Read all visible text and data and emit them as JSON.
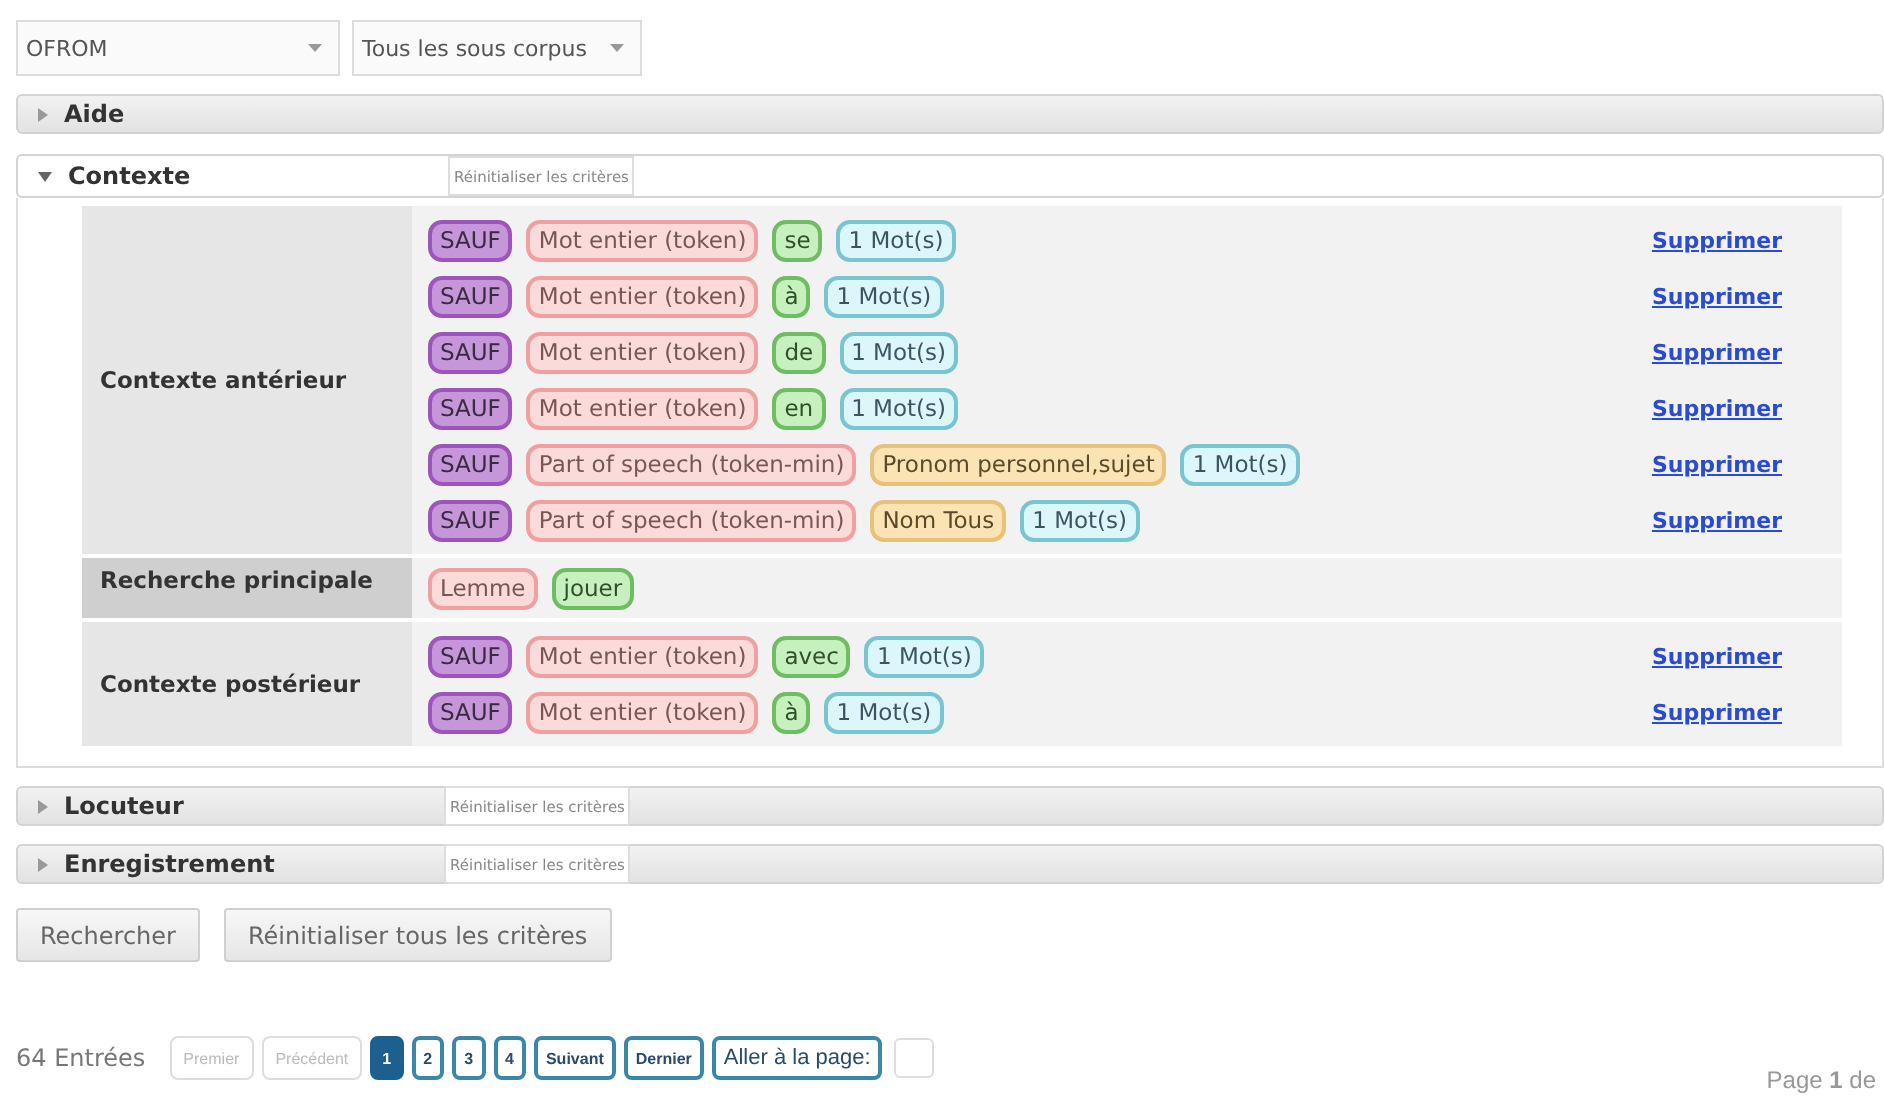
{
  "selects": [
    {
      "value": "OFROM"
    },
    {
      "value": "Tous les sous corpus"
    }
  ],
  "sections": [
    {
      "title": "Aide",
      "expanded": false
    },
    {
      "title": "Contexte",
      "expanded": true,
      "reset": "Réinitialiser les critères",
      "groups": [
        {
          "label": "Contexte antérieur",
          "kind": "context",
          "rows": [
            {
              "tags": [
                {
                  "kind": "sauf",
                  "text": "SAUF"
                },
                {
                  "kind": "field",
                  "text": "Mot entier (token)"
                },
                {
                  "kind": "value",
                  "text": "se"
                },
                {
                  "kind": "count",
                  "text": "1 Mot(s)"
                }
              ],
              "action": "Supprimer"
            },
            {
              "tags": [
                {
                  "kind": "sauf",
                  "text": "SAUF"
                },
                {
                  "kind": "field",
                  "text": "Mot entier (token)"
                },
                {
                  "kind": "value",
                  "text": "à"
                },
                {
                  "kind": "count",
                  "text": "1 Mot(s)"
                }
              ],
              "action": "Supprimer"
            },
            {
              "tags": [
                {
                  "kind": "sauf",
                  "text": "SAUF"
                },
                {
                  "kind": "field",
                  "text": "Mot entier (token)"
                },
                {
                  "kind": "value",
                  "text": "de"
                },
                {
                  "kind": "count",
                  "text": "1 Mot(s)"
                }
              ],
              "action": "Supprimer"
            },
            {
              "tags": [
                {
                  "kind": "sauf",
                  "text": "SAUF"
                },
                {
                  "kind": "field",
                  "text": "Mot entier (token)"
                },
                {
                  "kind": "value",
                  "text": "en"
                },
                {
                  "kind": "count",
                  "text": "1 Mot(s)"
                }
              ],
              "action": "Supprimer"
            },
            {
              "tags": [
                {
                  "kind": "sauf",
                  "text": "SAUF"
                },
                {
                  "kind": "field",
                  "text": "Part of speech (token-min)"
                },
                {
                  "kind": "pos",
                  "text": "Pronom personnel,sujet"
                },
                {
                  "kind": "count",
                  "text": "1 Mot(s)"
                }
              ],
              "action": "Supprimer"
            },
            {
              "tags": [
                {
                  "kind": "sauf",
                  "text": "SAUF"
                },
                {
                  "kind": "field",
                  "text": "Part of speech (token-min)"
                },
                {
                  "kind": "pos",
                  "text": "Nom Tous"
                },
                {
                  "kind": "count",
                  "text": "1 Mot(s)"
                }
              ],
              "action": "Supprimer"
            }
          ]
        },
        {
          "label": "Recherche principale",
          "kind": "main",
          "rows": [
            {
              "tags": [
                {
                  "kind": "field",
                  "text": "Lemme"
                },
                {
                  "kind": "value",
                  "text": "jouer"
                }
              ]
            }
          ]
        },
        {
          "label": "Contexte postérieur",
          "kind": "context",
          "rows": [
            {
              "tags": [
                {
                  "kind": "sauf",
                  "text": "SAUF"
                },
                {
                  "kind": "field",
                  "text": "Mot entier (token)"
                },
                {
                  "kind": "value",
                  "text": "avec"
                },
                {
                  "kind": "count",
                  "text": "1 Mot(s)"
                }
              ],
              "action": "Supprimer"
            },
            {
              "tags": [
                {
                  "kind": "sauf",
                  "text": "SAUF"
                },
                {
                  "kind": "field",
                  "text": "Mot entier (token)"
                },
                {
                  "kind": "value",
                  "text": "à"
                },
                {
                  "kind": "count",
                  "text": "1 Mot(s)"
                }
              ],
              "action": "Supprimer"
            }
          ]
        }
      ]
    },
    {
      "title": "Locuteur",
      "expanded": false,
      "reset": "Réinitialiser les critères"
    },
    {
      "title": "Enregistrement",
      "expanded": false,
      "reset": "Réinitialiser les critères"
    }
  ],
  "buttons": [
    "Rechercher",
    "Réinitialiser tous les critères"
  ],
  "pager": {
    "entries": "64 Entrées",
    "items": [
      {
        "label": "Premier",
        "kind": "nav",
        "disabled": true,
        "selected": false
      },
      {
        "label": "Précédent",
        "kind": "nav",
        "disabled": true,
        "selected": false
      },
      {
        "label": "1",
        "kind": "page",
        "disabled": false,
        "selected": true
      },
      {
        "label": "2",
        "kind": "page",
        "disabled": false,
        "selected": false
      },
      {
        "label": "3",
        "kind": "page",
        "disabled": false,
        "selected": false
      },
      {
        "label": "4",
        "kind": "page",
        "disabled": false,
        "selected": false
      },
      {
        "label": "Suivant",
        "kind": "nav",
        "disabled": false,
        "selected": false
      },
      {
        "label": "Dernier",
        "kind": "nav",
        "disabled": false,
        "selected": false
      },
      {
        "label": "Aller à la page:",
        "kind": "goto",
        "disabled": false,
        "selected": false
      }
    ],
    "status": "Page **1** de"
  }
}
